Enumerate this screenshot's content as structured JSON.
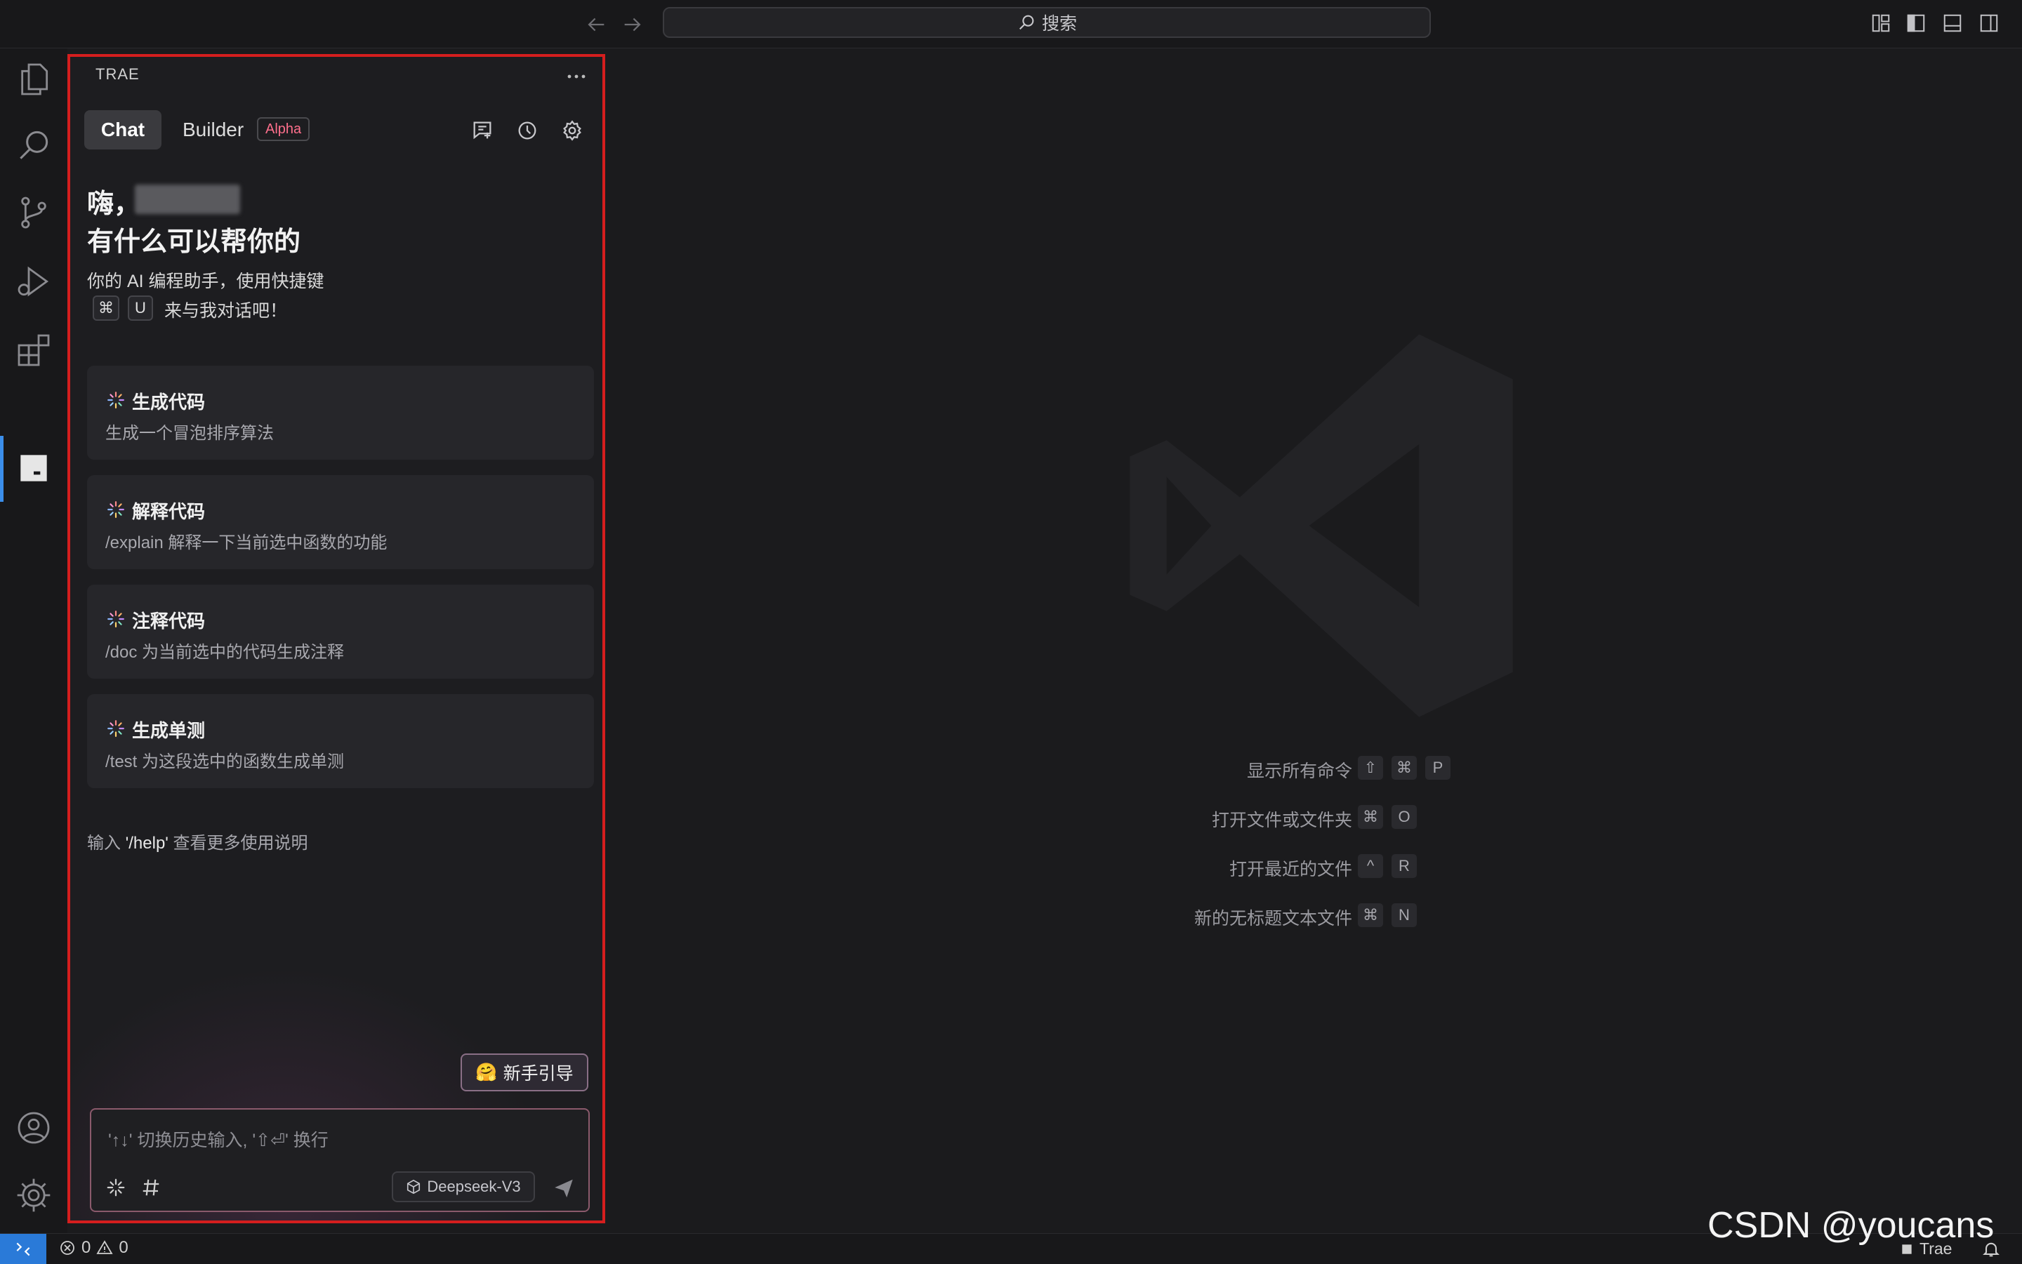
{
  "titlebar": {
    "search_label": "搜索"
  },
  "activity_bar": {
    "items": [
      "explorer-icon",
      "search-icon",
      "source-control-icon",
      "run-debug-icon",
      "extensions-icon",
      "trae-icon"
    ],
    "bottom": [
      "account-icon",
      "settings-gear-icon"
    ]
  },
  "panel": {
    "title": "TRAE",
    "tabs": {
      "chat": "Chat",
      "builder": "Builder",
      "alpha": "Alpha"
    },
    "greeting": "嗨，",
    "greeting_sub": "有什么可以帮你的",
    "intro_line1": "你的 AI 编程助手，使用快捷键",
    "intro_key1": "⌘",
    "intro_key2": "U",
    "intro_line2": "来与我对话吧！",
    "cards": [
      {
        "title": "生成代码",
        "desc": "生成一个冒泡排序算法"
      },
      {
        "title": "解释代码",
        "desc": "/explain 解释一下当前选中函数的功能"
      },
      {
        "title": "注释代码",
        "desc": "/doc 为当前选中的代码生成注释"
      },
      {
        "title": "生成单测",
        "desc": "/test 为这段选中的函数生成单测"
      }
    ],
    "help_prefix": "输入 ",
    "help_cmd": "'/help'",
    "help_suffix": " 查看更多使用说明",
    "guide_emoji": "🤗",
    "guide_label": "新手引导",
    "input_placeholder": "'↑↓' 切换历史输入, '⇧⏎' 换行",
    "model": "Deepseek-V3"
  },
  "editor": {
    "shortcuts": [
      {
        "label": "显示所有命令",
        "keys": [
          "⇧",
          "⌘",
          "P"
        ]
      },
      {
        "label": "打开文件或文件夹",
        "keys": [
          "⌘",
          "O"
        ]
      },
      {
        "label": "打开最近的文件",
        "keys": [
          "^",
          "R"
        ]
      },
      {
        "label": "新的无标题文本文件",
        "keys": [
          "⌘",
          "N"
        ]
      }
    ]
  },
  "statusbar": {
    "errors": "0",
    "warnings": "0",
    "trae_label": "Trae"
  },
  "watermark": "CSDN @youcans",
  "colors": {
    "accent": "#2a7ad8",
    "highlight_border": "#d51e1e",
    "alpha_badge": "#ff6f8c"
  }
}
